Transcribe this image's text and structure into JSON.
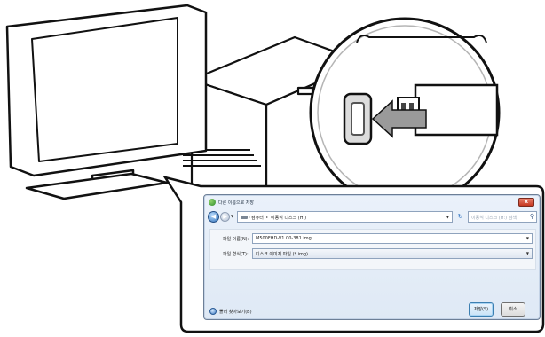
{
  "dialog": {
    "title": "다른 이름으로 저장",
    "close_label": "x",
    "nav": {
      "back_icon": "back-arrow-icon",
      "forward_icon": "forward-arrow-icon",
      "breadcrumbs": [
        "컴퓨터",
        "이동식 디스크 (H:)"
      ],
      "refresh_label": "↻",
      "search_placeholder": "이동식 디스크 (H:) 검색"
    },
    "file_name_label": "파일 이름(N):",
    "file_name_value": "M500FHD-V1.00-381.img",
    "file_type_label": "파일 형식(T):",
    "file_type_value": "디스크 이미지 파일 (*.img)",
    "browse_folders_label": "폴더 찾아보기(B)",
    "save_label": "저장(S)",
    "cancel_label": "취소"
  },
  "illustration": {
    "description_items": [
      "monitor",
      "computer-tower",
      "usb-port-magnifier",
      "usb-drive-arrow"
    ]
  }
}
